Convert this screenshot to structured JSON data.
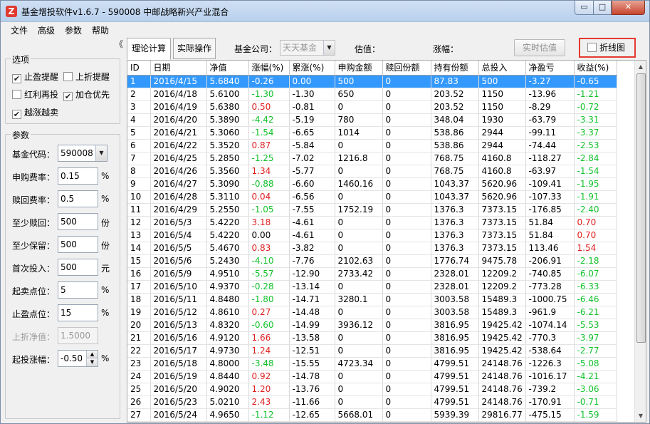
{
  "window": {
    "title": "基金增投软件v1.6.7 - 590008 中邮战略新兴产业混合",
    "app_icon": "Z",
    "min_glyph": "▭",
    "max_glyph": "□",
    "close_glyph": "✕"
  },
  "menu": [
    "文件",
    "高级",
    "参数",
    "帮助"
  ],
  "left": {
    "collapse_glyph": "《",
    "options_title": "选项",
    "options": [
      {
        "label": "止盈提醒",
        "checked": true
      },
      {
        "label": "上折提醒",
        "checked": false
      },
      {
        "label": "红利再投",
        "checked": false
      },
      {
        "label": "加仓优先",
        "checked": true
      },
      {
        "label": "越涨越卖",
        "checked": true
      }
    ],
    "params_title": "参数",
    "params": [
      {
        "label": "基金代码：",
        "value": "590008",
        "unit": ""
      },
      {
        "label": "申购费率：",
        "value": "0.15",
        "unit": "%"
      },
      {
        "label": "赎回费率：",
        "value": "0.5",
        "unit": "%"
      },
      {
        "label": "至少赎回：",
        "value": "500",
        "unit": "份"
      },
      {
        "label": "至少保留：",
        "value": "500",
        "unit": "份"
      },
      {
        "label": "首次投入：",
        "value": "500",
        "unit": "元"
      },
      {
        "label": "起卖点位：",
        "value": "5",
        "unit": "%"
      },
      {
        "label": "止盈点位：",
        "value": "15",
        "unit": "%"
      },
      {
        "label": "上折净值：",
        "value": "1.5000",
        "unit": ""
      },
      {
        "label": "起投涨幅：",
        "value": "-0.50",
        "unit": "%"
      }
    ]
  },
  "toolbar": {
    "tab_calc": "理论计算",
    "tab_actual": "实际操作",
    "fund_company_label": "基金公司：",
    "fund_company_value": "天天基金",
    "estimate_label": "估值：",
    "change_label": "涨幅：",
    "realtime_button": "实时估值",
    "chart_toggle": "折线图"
  },
  "table": {
    "columns": [
      "ID",
      "日期",
      "净值",
      "涨幅(%)",
      "累涨(%)",
      "申购金额",
      "赎回份额",
      "持有份额",
      "总投入",
      "净盈亏",
      "收益(%)"
    ],
    "selected_row": 0,
    "rows": [
      [
        "1",
        "2016/4/15",
        "5.6840",
        "-0.26",
        "0.00",
        "500",
        "0",
        "87.83",
        "500",
        "-3.27",
        "-0.65"
      ],
      [
        "2",
        "2016/4/18",
        "5.6100",
        "-1.30",
        "-1.30",
        "650",
        "0",
        "203.52",
        "1150",
        "-13.96",
        "-1.21"
      ],
      [
        "3",
        "2016/4/19",
        "5.6380",
        "0.50",
        "-0.81",
        "0",
        "0",
        "203.52",
        "1150",
        "-8.29",
        "-0.72"
      ],
      [
        "4",
        "2016/4/20",
        "5.3890",
        "-4.42",
        "-5.19",
        "780",
        "0",
        "348.04",
        "1930",
        "-63.79",
        "-3.31"
      ],
      [
        "5",
        "2016/4/21",
        "5.3060",
        "-1.54",
        "-6.65",
        "1014",
        "0",
        "538.86",
        "2944",
        "-99.11",
        "-3.37"
      ],
      [
        "6",
        "2016/4/22",
        "5.3520",
        "0.87",
        "-5.84",
        "0",
        "0",
        "538.86",
        "2944",
        "-74.44",
        "-2.53"
      ],
      [
        "7",
        "2016/4/25",
        "5.2850",
        "-1.25",
        "-7.02",
        "1216.8",
        "0",
        "768.75",
        "4160.8",
        "-118.27",
        "-2.84"
      ],
      [
        "8",
        "2016/4/26",
        "5.3560",
        "1.34",
        "-5.77",
        "0",
        "0",
        "768.75",
        "4160.8",
        "-63.97",
        "-1.54"
      ],
      [
        "9",
        "2016/4/27",
        "5.3090",
        "-0.88",
        "-6.60",
        "1460.16",
        "0",
        "1043.37",
        "5620.96",
        "-109.41",
        "-1.95"
      ],
      [
        "10",
        "2016/4/28",
        "5.3110",
        "0.04",
        "-6.56",
        "0",
        "0",
        "1043.37",
        "5620.96",
        "-107.33",
        "-1.91"
      ],
      [
        "11",
        "2016/4/29",
        "5.2550",
        "-1.05",
        "-7.55",
        "1752.19",
        "0",
        "1376.3",
        "7373.15",
        "-176.85",
        "-2.40"
      ],
      [
        "12",
        "2016/5/3",
        "5.4220",
        "3.18",
        "-4.61",
        "0",
        "0",
        "1376.3",
        "7373.15",
        "51.84",
        "0.70"
      ],
      [
        "13",
        "2016/5/4",
        "5.4220",
        "0.00",
        "-4.61",
        "0",
        "0",
        "1376.3",
        "7373.15",
        "51.84",
        "0.70"
      ],
      [
        "14",
        "2016/5/5",
        "5.4670",
        "0.83",
        "-3.82",
        "0",
        "0",
        "1376.3",
        "7373.15",
        "113.46",
        "1.54"
      ],
      [
        "15",
        "2016/5/6",
        "5.2430",
        "-4.10",
        "-7.76",
        "2102.63",
        "0",
        "1776.74",
        "9475.78",
        "-206.91",
        "-2.18"
      ],
      [
        "16",
        "2016/5/9",
        "4.9510",
        "-5.57",
        "-12.90",
        "2733.42",
        "0",
        "2328.01",
        "12209.2",
        "-740.85",
        "-6.07"
      ],
      [
        "17",
        "2016/5/10",
        "4.9370",
        "-0.28",
        "-13.14",
        "0",
        "0",
        "2328.01",
        "12209.2",
        "-773.28",
        "-6.33"
      ],
      [
        "18",
        "2016/5/11",
        "4.8480",
        "-1.80",
        "-14.71",
        "3280.1",
        "0",
        "3003.58",
        "15489.3",
        "-1000.75",
        "-6.46"
      ],
      [
        "19",
        "2016/5/12",
        "4.8610",
        "0.27",
        "-14.48",
        "0",
        "0",
        "3003.58",
        "15489.3",
        "-961.9",
        "-6.21"
      ],
      [
        "20",
        "2016/5/13",
        "4.8320",
        "-0.60",
        "-14.99",
        "3936.12",
        "0",
        "3816.95",
        "19425.42",
        "-1074.14",
        "-5.53"
      ],
      [
        "21",
        "2016/5/16",
        "4.9120",
        "1.66",
        "-13.58",
        "0",
        "0",
        "3816.95",
        "19425.42",
        "-770.3",
        "-3.97"
      ],
      [
        "22",
        "2016/5/17",
        "4.9730",
        "1.24",
        "-12.51",
        "0",
        "0",
        "3816.95",
        "19425.42",
        "-538.64",
        "-2.77"
      ],
      [
        "23",
        "2016/5/18",
        "4.8000",
        "-3.48",
        "-15.55",
        "4723.34",
        "0",
        "4799.51",
        "24148.76",
        "-1226.3",
        "-5.08"
      ],
      [
        "24",
        "2016/5/19",
        "4.8440",
        "0.92",
        "-14.78",
        "0",
        "0",
        "4799.51",
        "24148.76",
        "-1016.17",
        "-4.21"
      ],
      [
        "25",
        "2016/5/20",
        "4.9020",
        "1.20",
        "-13.76",
        "0",
        "0",
        "4799.51",
        "24148.76",
        "-739.2",
        "-3.06"
      ],
      [
        "26",
        "2016/5/23",
        "5.0210",
        "2.43",
        "-11.66",
        "0",
        "0",
        "4799.51",
        "24148.76",
        "-170.91",
        "-0.71"
      ],
      [
        "27",
        "2016/5/24",
        "4.9650",
        "-1.12",
        "-12.65",
        "5668.01",
        "0",
        "5939.39",
        "29816.77",
        "-475.15",
        "-1.59"
      ]
    ]
  },
  "colors": {
    "positive": "#e02020",
    "negative": "#12c12c",
    "selection": "#3399ff",
    "highlight_border": "#e53a2f"
  }
}
